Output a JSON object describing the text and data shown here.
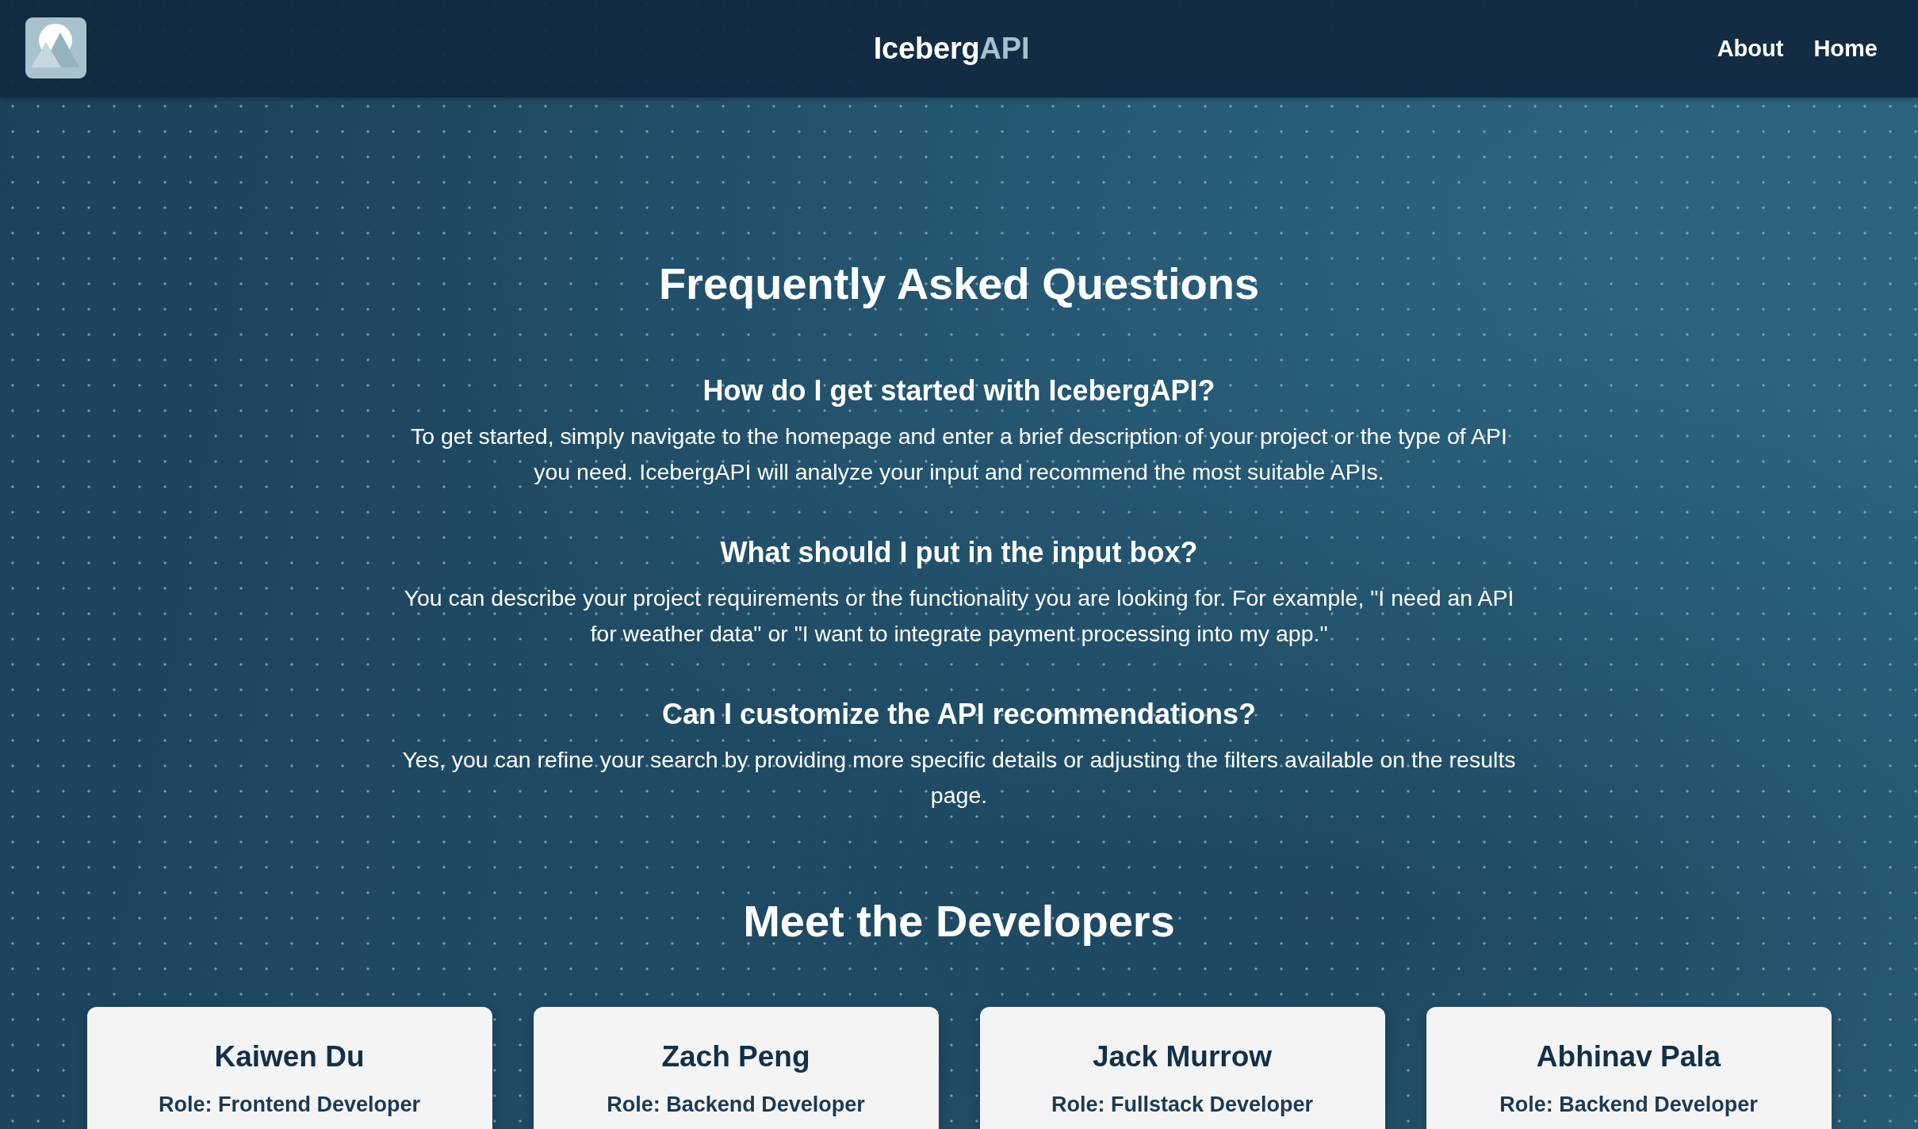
{
  "header": {
    "title": {
      "name": "Iceberg",
      "accent": "API"
    },
    "nav": [
      {
        "label": "About"
      },
      {
        "label": "Home"
      }
    ]
  },
  "faq": {
    "heading": "Frequently Asked Questions",
    "items": [
      {
        "question": "How do I get started with IcebergAPI?",
        "answer": "To get started, simply navigate to the homepage and enter a brief description of your project or the type of API you need. IcebergAPI will analyze your input and recommend the most suitable APIs."
      },
      {
        "question": "What should I put in the input box?",
        "answer": "You can describe your project requirements or the functionality you are looking for. For example, \"I need an API for weather data\" or \"I want to integrate payment processing into my app.\""
      },
      {
        "question": "Can I customize the API recommendations?",
        "answer": "Yes, you can refine your search by providing more specific details or adjusting the filters available on the results page."
      }
    ]
  },
  "developers": {
    "heading": "Meet the Developers",
    "cards": [
      {
        "name": "Kaiwen Du",
        "role": "Role: Frontend Developer"
      },
      {
        "name": "Zach Peng",
        "role": "Role: Backend Developer"
      },
      {
        "name": "Jack Murrow",
        "role": "Role: Fullstack Developer"
      },
      {
        "name": "Abhinav Pala",
        "role": "Role: Backend Developer"
      }
    ]
  }
}
